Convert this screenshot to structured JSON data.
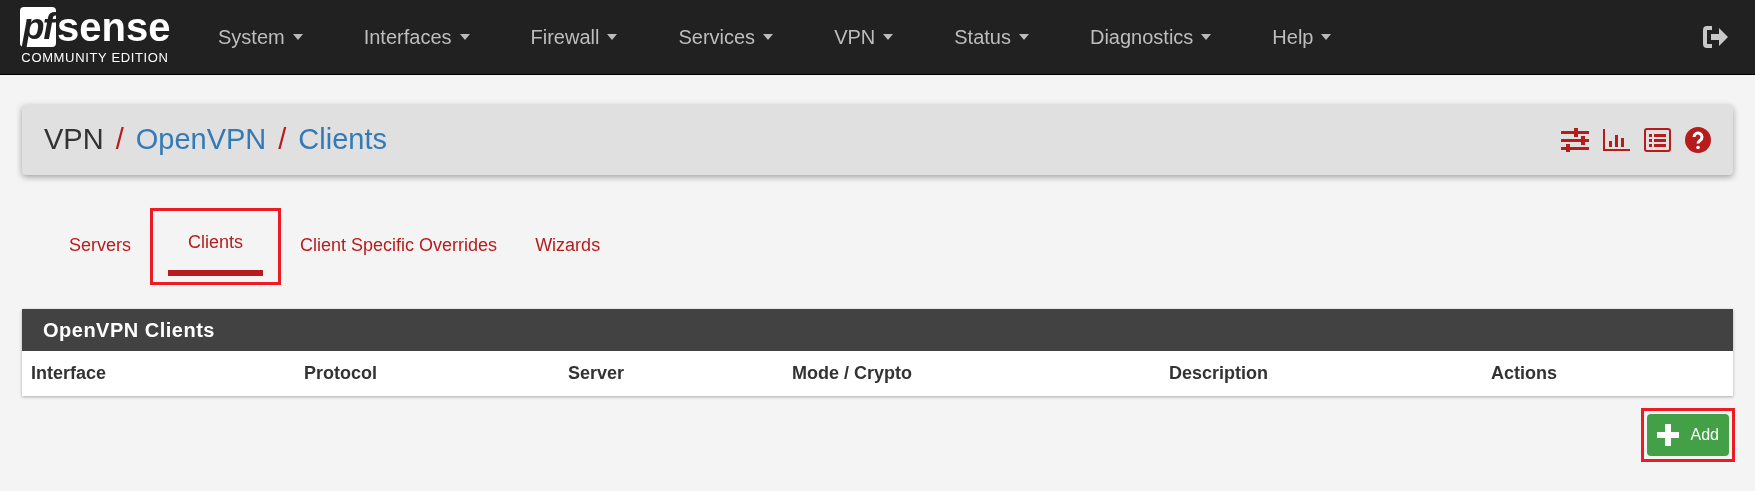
{
  "brand": {
    "mark": "pf",
    "name": "sense",
    "edition": "COMMUNITY EDITION"
  },
  "nav": [
    {
      "label": "System"
    },
    {
      "label": "Interfaces"
    },
    {
      "label": "Firewall"
    },
    {
      "label": "Services"
    },
    {
      "label": "VPN"
    },
    {
      "label": "Status"
    },
    {
      "label": "Diagnostics"
    },
    {
      "label": "Help"
    }
  ],
  "breadcrumb": [
    {
      "label": "VPN",
      "link": false
    },
    {
      "label": "OpenVPN",
      "link": true
    },
    {
      "label": "Clients",
      "link": true
    }
  ],
  "breadcrumb_separator": "/",
  "tabs": [
    {
      "label": "Servers",
      "selected": false,
      "highlighted": false
    },
    {
      "label": "Clients",
      "selected": true,
      "highlighted": true
    },
    {
      "label": "Client Specific Overrides",
      "selected": false,
      "highlighted": false
    },
    {
      "label": "Wizards",
      "selected": false,
      "highlighted": false
    }
  ],
  "panel": {
    "title": "OpenVPN Clients",
    "columns": [
      "Interface",
      "Protocol",
      "Server",
      "Mode / Crypto",
      "Description",
      "Actions"
    ]
  },
  "add_button": {
    "label": "Add",
    "highlighted": true
  }
}
